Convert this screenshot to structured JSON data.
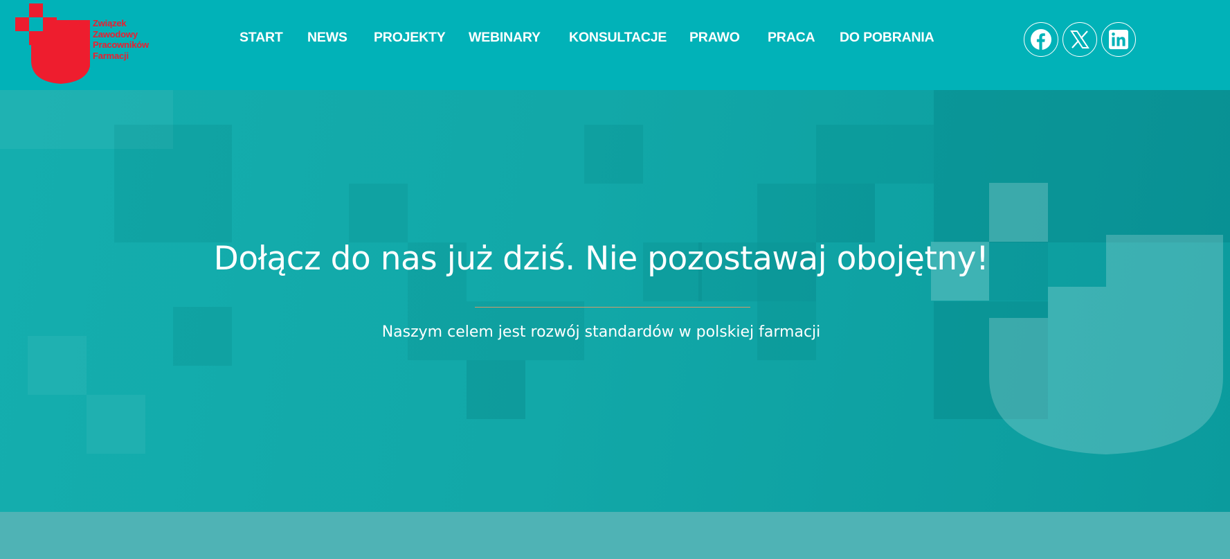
{
  "header": {
    "logo_lines": [
      "Związek",
      "Zawodowy",
      "Pracowników",
      "Farmacji"
    ],
    "logo_color": "#ee1d2e",
    "background": "#01b2b8"
  },
  "nav": {
    "items": [
      {
        "label": "START"
      },
      {
        "label": "NEWS"
      },
      {
        "label": "PROJEKTY"
      },
      {
        "label": "WEBINARY"
      },
      {
        "label": "KONSULTACJE"
      },
      {
        "label": "PRAWO"
      },
      {
        "label": "PRACA"
      },
      {
        "label": "DO POBRANIA"
      }
    ]
  },
  "social": [
    {
      "icon": "facebook-icon"
    },
    {
      "icon": "x-icon"
    },
    {
      "icon": "linkedin-icon"
    }
  ],
  "hero": {
    "title": "Dołącz do nas już dziś. Nie pozostawaj obojętny!",
    "subtitle": "Naszym celem jest rozwój standardów w polskiej farmacji",
    "divider_color": "#d19a6a"
  }
}
